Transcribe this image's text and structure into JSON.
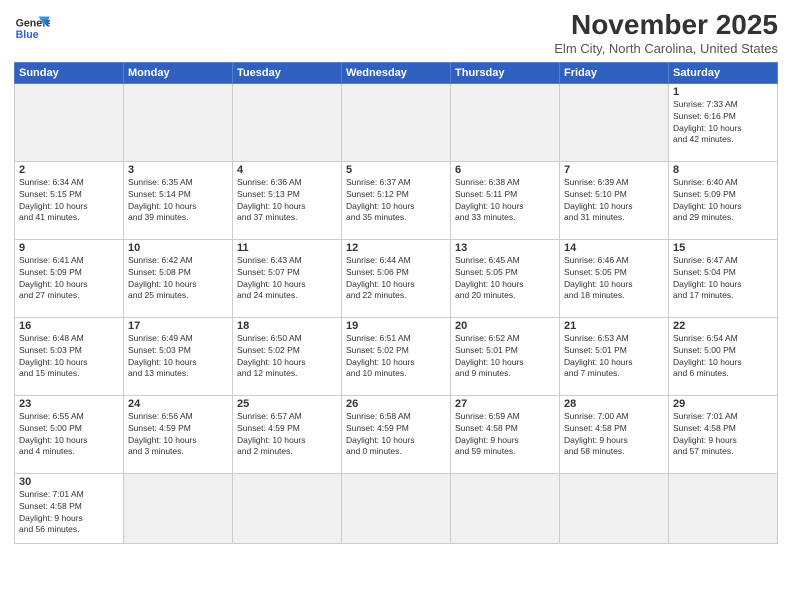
{
  "header": {
    "logo_line1": "General",
    "logo_line2": "Blue",
    "month": "November 2025",
    "location": "Elm City, North Carolina, United States"
  },
  "days_of_week": [
    "Sunday",
    "Monday",
    "Tuesday",
    "Wednesday",
    "Thursday",
    "Friday",
    "Saturday"
  ],
  "weeks": [
    [
      {
        "day": "",
        "empty": true
      },
      {
        "day": "",
        "empty": true
      },
      {
        "day": "",
        "empty": true
      },
      {
        "day": "",
        "empty": true
      },
      {
        "day": "",
        "empty": true
      },
      {
        "day": "",
        "empty": true
      },
      {
        "day": "1",
        "info": "Sunrise: 7:33 AM\nSunset: 6:16 PM\nDaylight: 10 hours\nand 42 minutes."
      }
    ],
    [
      {
        "day": "2",
        "info": "Sunrise: 6:34 AM\nSunset: 5:15 PM\nDaylight: 10 hours\nand 41 minutes."
      },
      {
        "day": "3",
        "info": "Sunrise: 6:35 AM\nSunset: 5:14 PM\nDaylight: 10 hours\nand 39 minutes."
      },
      {
        "day": "4",
        "info": "Sunrise: 6:36 AM\nSunset: 5:13 PM\nDaylight: 10 hours\nand 37 minutes."
      },
      {
        "day": "5",
        "info": "Sunrise: 6:37 AM\nSunset: 5:12 PM\nDaylight: 10 hours\nand 35 minutes."
      },
      {
        "day": "6",
        "info": "Sunrise: 6:38 AM\nSunset: 5:11 PM\nDaylight: 10 hours\nand 33 minutes."
      },
      {
        "day": "7",
        "info": "Sunrise: 6:39 AM\nSunset: 5:10 PM\nDaylight: 10 hours\nand 31 minutes."
      },
      {
        "day": "8",
        "info": "Sunrise: 6:40 AM\nSunset: 5:09 PM\nDaylight: 10 hours\nand 29 minutes."
      }
    ],
    [
      {
        "day": "9",
        "info": "Sunrise: 6:41 AM\nSunset: 5:09 PM\nDaylight: 10 hours\nand 27 minutes."
      },
      {
        "day": "10",
        "info": "Sunrise: 6:42 AM\nSunset: 5:08 PM\nDaylight: 10 hours\nand 25 minutes."
      },
      {
        "day": "11",
        "info": "Sunrise: 6:43 AM\nSunset: 5:07 PM\nDaylight: 10 hours\nand 24 minutes."
      },
      {
        "day": "12",
        "info": "Sunrise: 6:44 AM\nSunset: 5:06 PM\nDaylight: 10 hours\nand 22 minutes."
      },
      {
        "day": "13",
        "info": "Sunrise: 6:45 AM\nSunset: 5:05 PM\nDaylight: 10 hours\nand 20 minutes."
      },
      {
        "day": "14",
        "info": "Sunrise: 6:46 AM\nSunset: 5:05 PM\nDaylight: 10 hours\nand 18 minutes."
      },
      {
        "day": "15",
        "info": "Sunrise: 6:47 AM\nSunset: 5:04 PM\nDaylight: 10 hours\nand 17 minutes."
      }
    ],
    [
      {
        "day": "16",
        "info": "Sunrise: 6:48 AM\nSunset: 5:03 PM\nDaylight: 10 hours\nand 15 minutes."
      },
      {
        "day": "17",
        "info": "Sunrise: 6:49 AM\nSunset: 5:03 PM\nDaylight: 10 hours\nand 13 minutes."
      },
      {
        "day": "18",
        "info": "Sunrise: 6:50 AM\nSunset: 5:02 PM\nDaylight: 10 hours\nand 12 minutes."
      },
      {
        "day": "19",
        "info": "Sunrise: 6:51 AM\nSunset: 5:02 PM\nDaylight: 10 hours\nand 10 minutes."
      },
      {
        "day": "20",
        "info": "Sunrise: 6:52 AM\nSunset: 5:01 PM\nDaylight: 10 hours\nand 9 minutes."
      },
      {
        "day": "21",
        "info": "Sunrise: 6:53 AM\nSunset: 5:01 PM\nDaylight: 10 hours\nand 7 minutes."
      },
      {
        "day": "22",
        "info": "Sunrise: 6:54 AM\nSunset: 5:00 PM\nDaylight: 10 hours\nand 6 minutes."
      }
    ],
    [
      {
        "day": "23",
        "info": "Sunrise: 6:55 AM\nSunset: 5:00 PM\nDaylight: 10 hours\nand 4 minutes."
      },
      {
        "day": "24",
        "info": "Sunrise: 6:56 AM\nSunset: 4:59 PM\nDaylight: 10 hours\nand 3 minutes."
      },
      {
        "day": "25",
        "info": "Sunrise: 6:57 AM\nSunset: 4:59 PM\nDaylight: 10 hours\nand 2 minutes."
      },
      {
        "day": "26",
        "info": "Sunrise: 6:58 AM\nSunset: 4:59 PM\nDaylight: 10 hours\nand 0 minutes."
      },
      {
        "day": "27",
        "info": "Sunrise: 6:59 AM\nSunset: 4:58 PM\nDaylight: 9 hours\nand 59 minutes."
      },
      {
        "day": "28",
        "info": "Sunrise: 7:00 AM\nSunset: 4:58 PM\nDaylight: 9 hours\nand 58 minutes."
      },
      {
        "day": "29",
        "info": "Sunrise: 7:01 AM\nSunset: 4:58 PM\nDaylight: 9 hours\nand 57 minutes."
      }
    ],
    [
      {
        "day": "30",
        "info": "Sunrise: 7:01 AM\nSunset: 4:58 PM\nDaylight: 9 hours\nand 56 minutes.",
        "last": true
      },
      {
        "day": "",
        "empty": true,
        "last": true
      },
      {
        "day": "",
        "empty": true,
        "last": true
      },
      {
        "day": "",
        "empty": true,
        "last": true
      },
      {
        "day": "",
        "empty": true,
        "last": true
      },
      {
        "day": "",
        "empty": true,
        "last": true
      },
      {
        "day": "",
        "empty": true,
        "last": true
      }
    ]
  ]
}
